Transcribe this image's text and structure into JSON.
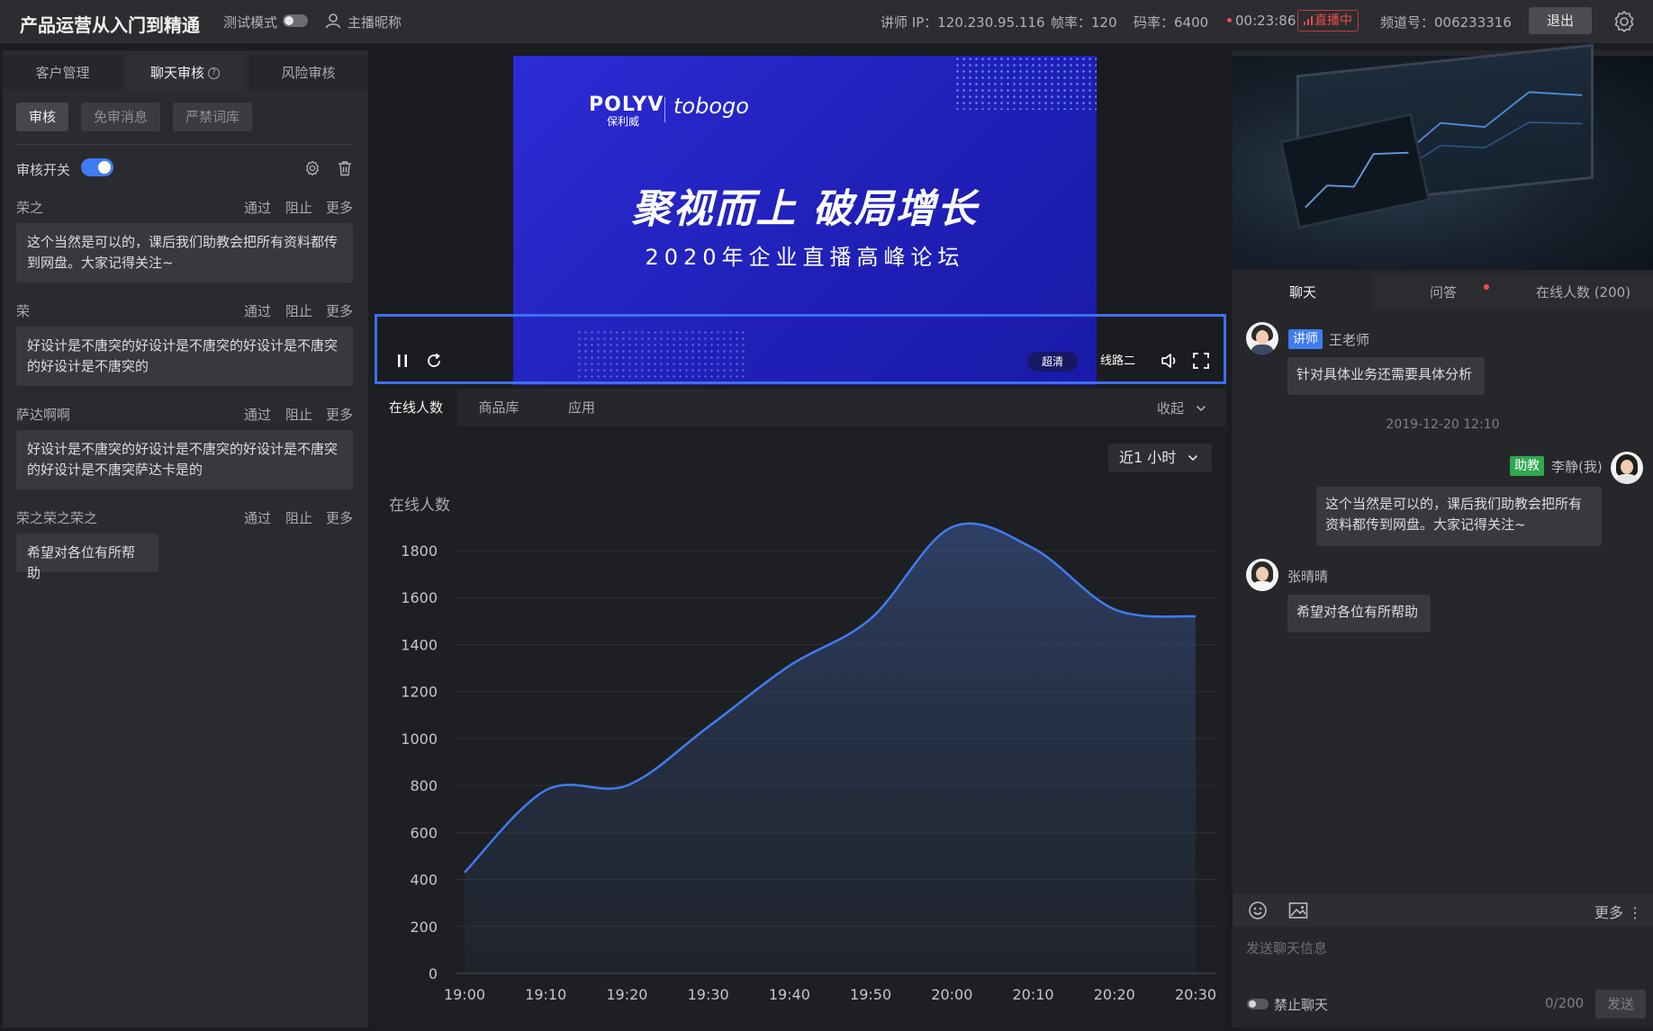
{
  "header": {
    "title": "产品运营从入门到精通",
    "test_mode_label": "测试模式",
    "host_name": "主播昵称",
    "lecturer_ip": "讲师 IP：120.230.95.116",
    "frame_rate": "帧率：120",
    "bit_rate": "码率：6400",
    "duration": "00:23:86",
    "live_status": "直播中",
    "channel_id": "频道号：006233316",
    "exit_label": "退出",
    "live_color": "#f04b4b"
  },
  "left_panel": {
    "tabs": [
      {
        "label": "客户管理"
      },
      {
        "label": "聊天审核"
      },
      {
        "label": "风险审核"
      }
    ],
    "subtabs": [
      {
        "label": "审核"
      },
      {
        "label": "免审消息"
      },
      {
        "label": "严禁词库"
      }
    ],
    "review_switch_label": "审核开关",
    "action_labels": {
      "pass": "通过",
      "block": "阻止",
      "more": "更多"
    },
    "messages": [
      {
        "name": "荣之",
        "text": "这个当然是可以的，课后我们助教会把所有资料都传到网盘。大家记得关注~"
      },
      {
        "name": "荣",
        "text": "好设计是不唐突的好设计是不唐突的好设计是不唐突的好设计是不唐突的"
      },
      {
        "name": "萨达啊啊",
        "text": "好设计是不唐突的好设计是不唐突的好设计是不唐突的好设计是不唐突萨达卡是的"
      },
      {
        "name": "荣之荣之荣之",
        "text": "希望对各位有所帮助"
      }
    ]
  },
  "video": {
    "logo_brand": "POLYV",
    "logo_brand_sub": "保利威",
    "logo_partner": "tobogo",
    "slogan_main": "聚视而上 破局增长",
    "slogan_sub": "2020年企业直播高峰论坛",
    "quality_label": "超清",
    "line_label": "线路二"
  },
  "center_tabs": [
    {
      "label": "在线人数"
    },
    {
      "label": "商品库"
    },
    {
      "label": "应用"
    }
  ],
  "collapse_label": "收起",
  "range_select": "近1 小时",
  "chart_data": {
    "type": "area",
    "title": "在线人数",
    "x": [
      "19:00",
      "19:10",
      "19:20",
      "19:30",
      "19:40",
      "19:50",
      "20:00",
      "20:10",
      "20:20",
      "20:30"
    ],
    "values": [
      430,
      780,
      800,
      1050,
      1310,
      1510,
      1900,
      1810,
      1550,
      1520
    ],
    "ylim": [
      0,
      1800
    ],
    "yticks": [
      "0",
      "200",
      "400",
      "600",
      "800",
      "1000",
      "1200",
      "1400",
      "1600",
      "1800"
    ],
    "grid": true,
    "line_color": "#3f7cf2"
  },
  "right_panel": {
    "tabs": [
      {
        "label": "聊天"
      },
      {
        "label": "问答"
      },
      {
        "label": "在线人数 (200)"
      }
    ],
    "chat": [
      {
        "role": "讲师",
        "name": "王老师",
        "text": "针对具体业务还需要具体分析"
      },
      {
        "time": "2019-12-20 12:10"
      },
      {
        "role": "助教",
        "name": "李静(我)",
        "text": "这个当然是可以的，课后我们助教会把所有资料都传到网盘。大家记得关注~"
      },
      {
        "name": "张晴晴",
        "text": "希望对各位有所帮助"
      }
    ],
    "role_colors": {
      "lecturer": "#3f7cf2",
      "assistant": "#2fa84f"
    },
    "more_label": "更多",
    "input_placeholder": "发送聊天信息",
    "ban_chat_label": "禁止聊天",
    "char_count": "0/200",
    "send_label": "发送"
  }
}
